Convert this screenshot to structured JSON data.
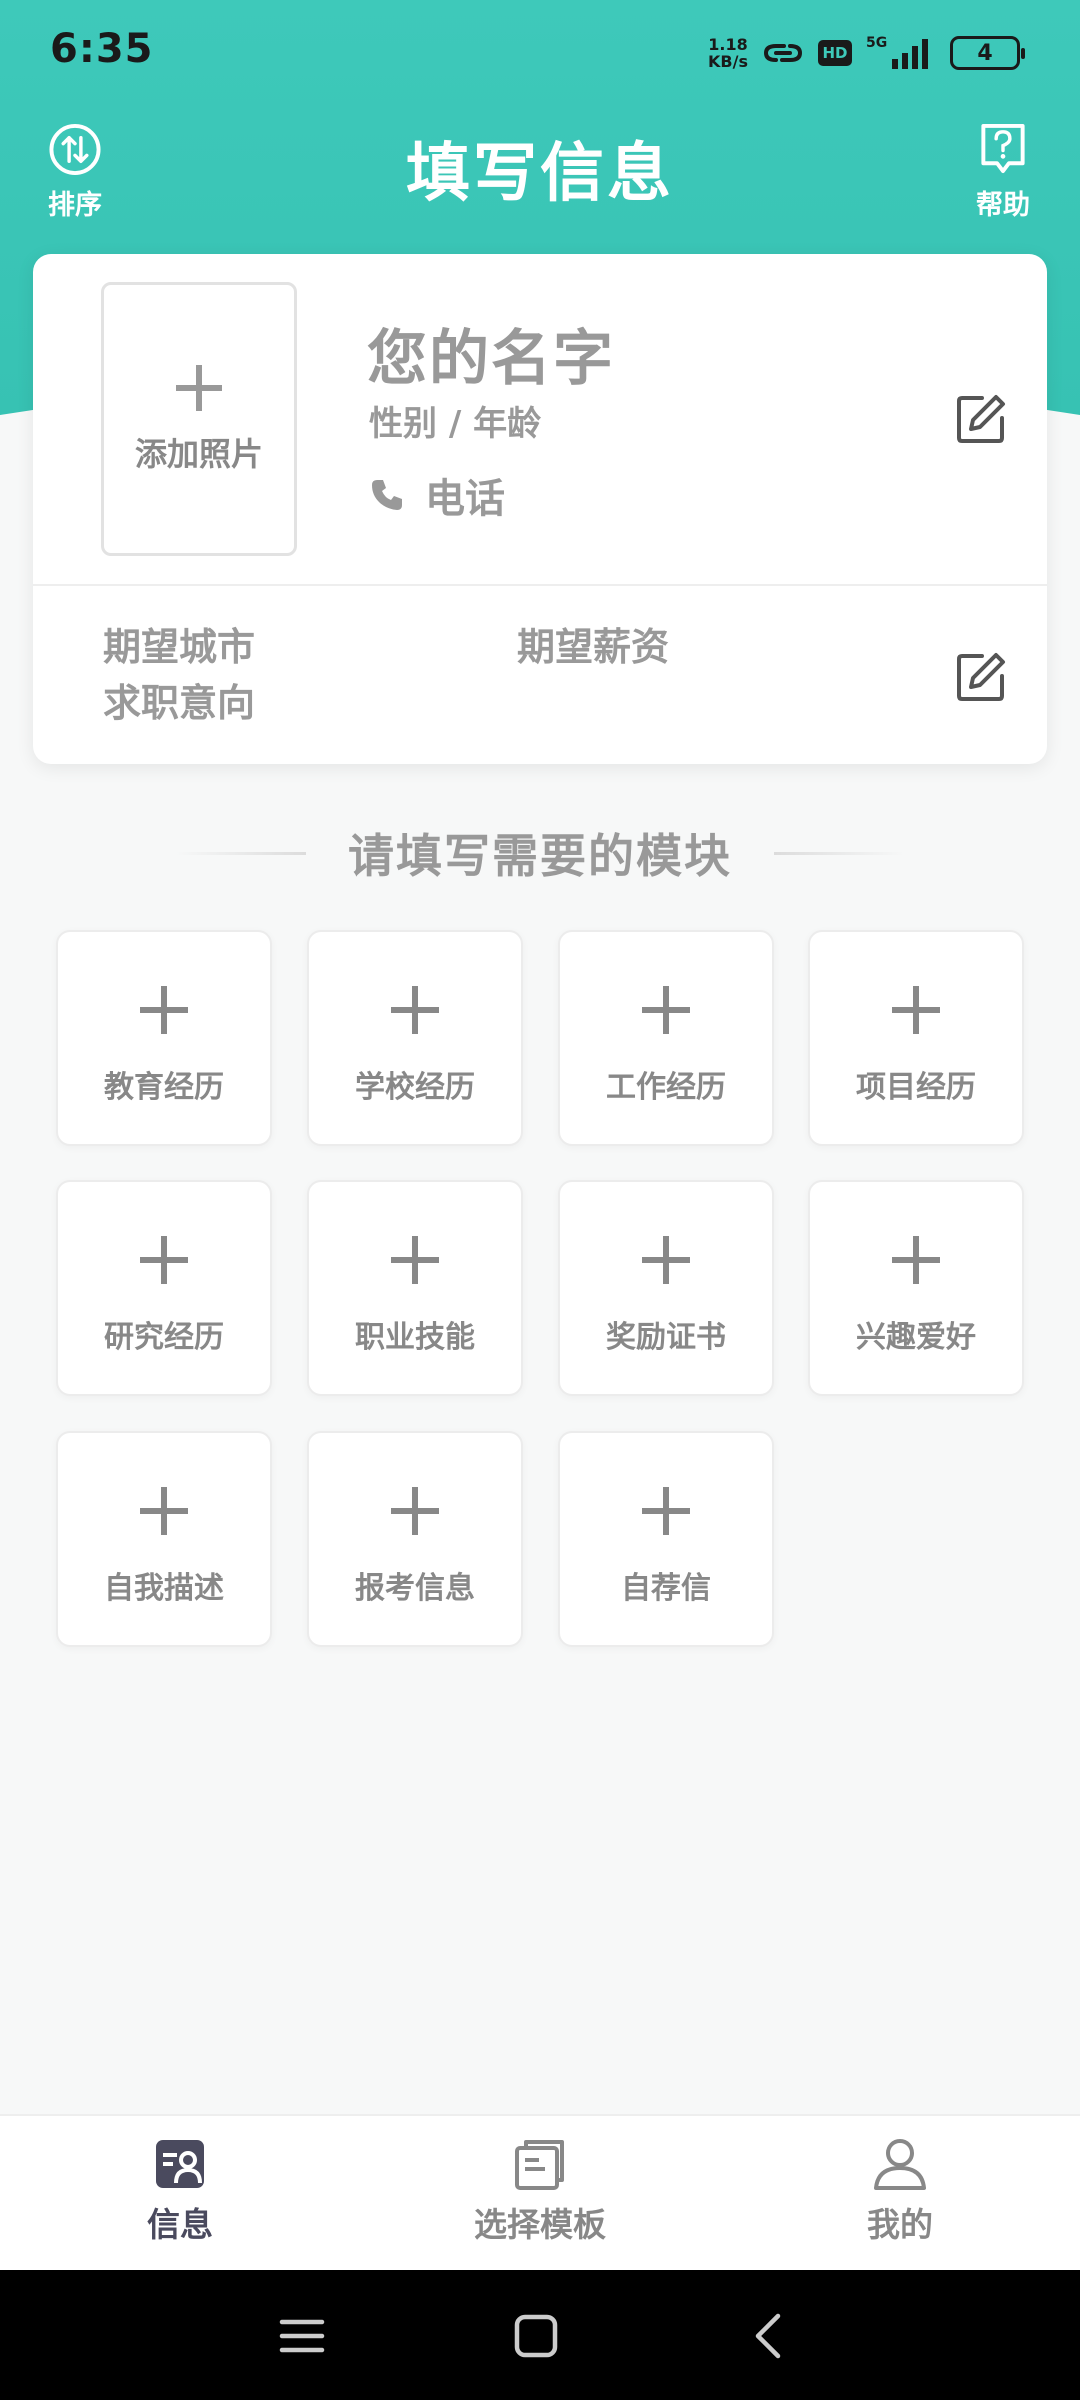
{
  "colors": {
    "header_teal": "#3ec9ba",
    "header_teal_light": "#37c2b3",
    "label_gray": "#999999",
    "active_nav": "#4a4a5e",
    "inactive_nav": "#888888"
  },
  "status_bar": {
    "time": "6:35",
    "net_speed_value": "1.18",
    "net_speed_unit": "KB/s",
    "hd": "HD",
    "network": "5G",
    "battery": "4"
  },
  "app_bar": {
    "title": "填写信息",
    "sort_label": "排序",
    "sort_icon": "sort-arrows-icon",
    "help_label": "帮助",
    "help_icon": "help-question-icon"
  },
  "profile": {
    "add_photo_label": "添加照片",
    "name_placeholder": "您的名字",
    "gender_age_placeholder": "性别 / 年龄",
    "phone_placeholder": "电话",
    "expected_city": "期望城市",
    "job_intent": "求职意向",
    "expected_salary": "期望薪资"
  },
  "modules": {
    "section_title": "请填写需要的模块",
    "items": [
      {
        "label": "教育经历"
      },
      {
        "label": "学校经历"
      },
      {
        "label": "工作经历"
      },
      {
        "label": "项目经历"
      },
      {
        "label": "研究经历"
      },
      {
        "label": "职业技能"
      },
      {
        "label": "奖励证书"
      },
      {
        "label": "兴趣爱好"
      },
      {
        "label": "自我描述"
      },
      {
        "label": "报考信息"
      },
      {
        "label": "自荐信"
      }
    ]
  },
  "bottom_nav": {
    "items": [
      {
        "label": "信息",
        "icon": "info-card-icon",
        "active": true
      },
      {
        "label": "选择模板",
        "icon": "template-stack-icon",
        "active": false
      },
      {
        "label": "我的",
        "icon": "person-icon",
        "active": false
      }
    ]
  }
}
